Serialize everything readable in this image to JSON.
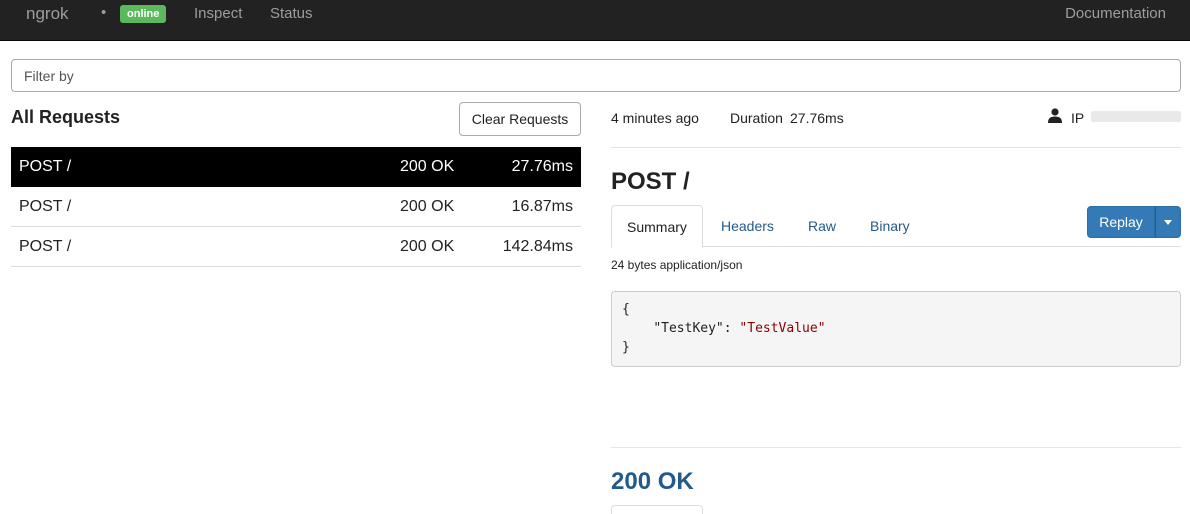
{
  "navbar": {
    "brand": "ngrok",
    "separator": "•",
    "status_badge": "online",
    "links": {
      "inspect": "Inspect",
      "status": "Status",
      "documentation": "Documentation"
    },
    "badge_color": "#5cb85c"
  },
  "filter": {
    "placeholder": "Filter by",
    "value": ""
  },
  "requests": {
    "title": "All Requests",
    "clear_label": "Clear Requests",
    "items": [
      {
        "method_path": "POST /",
        "status": "200 OK",
        "duration": "27.76ms",
        "selected": true
      },
      {
        "method_path": "POST /",
        "status": "200 OK",
        "duration": "16.87ms",
        "selected": false
      },
      {
        "method_path": "POST /",
        "status": "200 OK",
        "duration": "142.84ms",
        "selected": false
      }
    ]
  },
  "detail": {
    "time_ago": "4 minutes ago",
    "duration_label": "Duration",
    "duration_value": "27.76ms",
    "ip_label": "IP",
    "request_title": "POST /",
    "tabs": [
      "Summary",
      "Headers",
      "Raw",
      "Binary"
    ],
    "active_tab": "Summary",
    "replay_label": "Replay",
    "body_info": "24 bytes application/json",
    "code": {
      "open": "{",
      "key": "\"TestKey\"",
      "colon": ": ",
      "value": "\"TestValue\"",
      "close": "}"
    },
    "response_title": "200 OK",
    "accent_color": "#337ab7",
    "link_color": "#225a8c"
  }
}
